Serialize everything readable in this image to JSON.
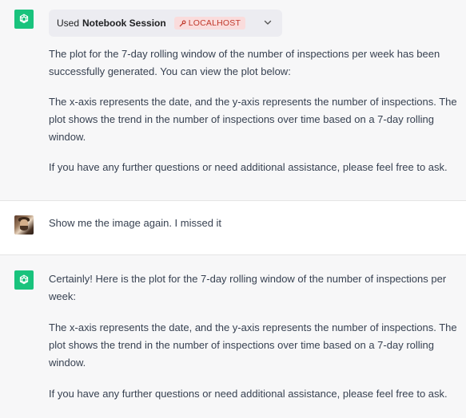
{
  "messages": [
    {
      "role": "assistant",
      "tool": {
        "used_label": "Used",
        "session_label": "Notebook Session",
        "badge_label": "LOCALHOST"
      },
      "paragraphs": [
        "The plot for the 7-day rolling window of the number of inspections per week has been successfully generated. You can view the plot below:",
        "The x-axis represents the date, and the y-axis represents the number of inspections. The plot shows the trend in the number of inspections over time based on a 7-day rolling window.",
        "If you have any further questions or need additional assistance, please feel free to ask."
      ]
    },
    {
      "role": "user",
      "paragraphs": [
        "Show me the image again. I missed it"
      ]
    },
    {
      "role": "assistant",
      "paragraphs": [
        "Certainly! Here is the plot for the 7-day rolling window of the number of inspections per week:",
        "The x-axis represents the date, and the y-axis represents the number of inspections. The plot shows the trend in the number of inspections over time based on a 7-day rolling window.",
        "If you have any further questions or need additional assistance, please feel free to ask."
      ]
    }
  ],
  "icons": {
    "assistant_avatar": "openai-logo-icon",
    "user_avatar": "user-photo-avatar",
    "badge_icon": "wrench-icon",
    "chip_toggle": "chevron-down-icon"
  },
  "colors": {
    "assistant_bg": "#f7f7f8",
    "user_bg": "#ffffff",
    "avatar_green": "#19c37d",
    "badge_bg": "#fadcdc",
    "badge_text": "#c0392b"
  }
}
